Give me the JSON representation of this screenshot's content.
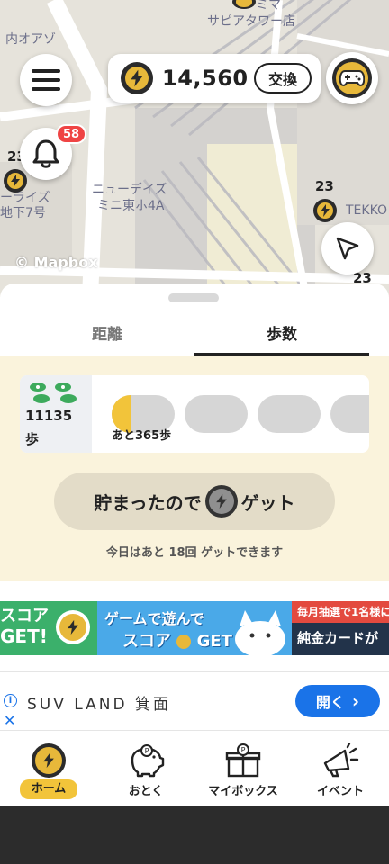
{
  "map": {
    "labels": [
      "サピアタワー店",
      "内オアゾ",
      "ニューデイズ",
      "ミニ東ホ4A",
      "ーライズ",
      "地下7号",
      "TEKKO",
      "ミマ"
    ],
    "pin_counts": [
      "23",
      "23",
      "23"
    ],
    "credit": "© Mapbox",
    "notification_count": "58"
  },
  "points": {
    "value": "14,560",
    "exchange_label": "交換"
  },
  "tabs": [
    {
      "label": "距離"
    },
    {
      "label": "歩数"
    }
  ],
  "steps": {
    "count": "11135",
    "unit": "歩",
    "remaining_label": "あと365歩",
    "first_slot_fill": 0.3
  },
  "get_button": {
    "part1": "貯まったので",
    "part2": "ゲット"
  },
  "remaining_today": "今日はあと 18回 ゲットできます",
  "promo": {
    "left_line1": "スコア",
    "left_line2": "GET!",
    "mid_line1": "ゲームで遊んで",
    "mid_line2": "スコア",
    "mid_line2b": "GET",
    "right_top": "毎月抽選で1名様に",
    "right_bottom": "純金カードが"
  },
  "ad": {
    "title": "SUV LAND 箕面",
    "open_label": "開く",
    "open_chevron": "›"
  },
  "nav": [
    {
      "label": "ホーム",
      "icon": "bolt-coin-icon"
    },
    {
      "label": "おとく",
      "icon": "piggy-bank-icon"
    },
    {
      "label": "マイボックス",
      "icon": "gift-box-icon"
    },
    {
      "label": "イベント",
      "icon": "megaphone-icon"
    }
  ],
  "colors": {
    "accent_yellow": "#f2c43a",
    "cream_bg": "#faf3dc",
    "badge_red": "#ef4444",
    "ad_blue": "#1a73e8"
  }
}
